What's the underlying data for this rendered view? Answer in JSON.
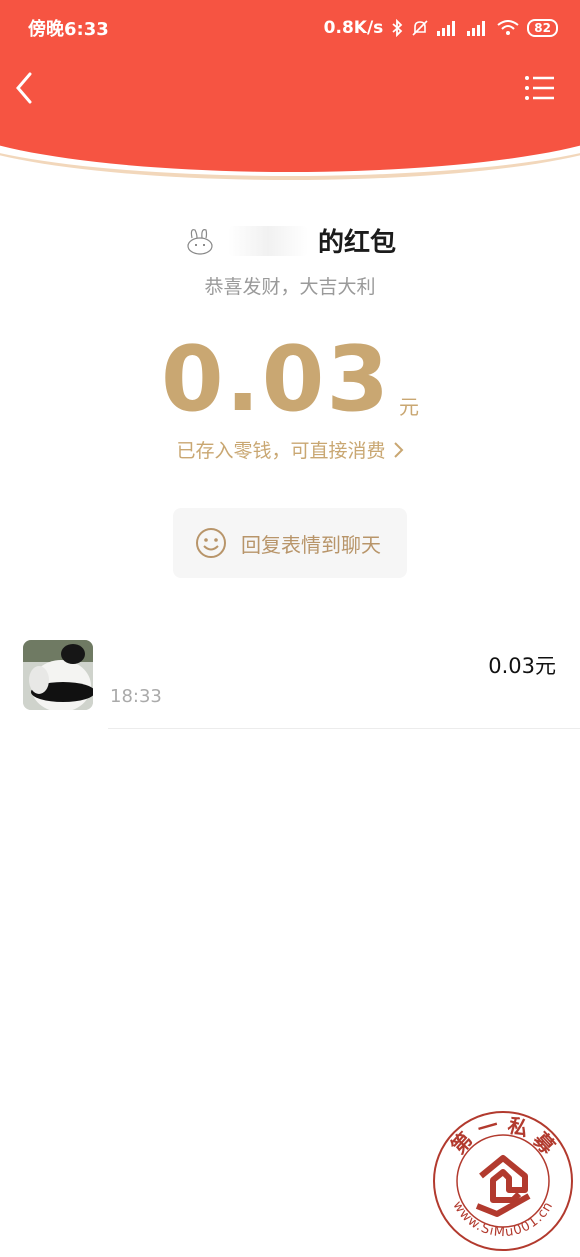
{
  "status_bar": {
    "time": "傍晚6:33",
    "speed": "0.8K/s",
    "battery": "82"
  },
  "nav": {
    "back_icon": "back-chevron-icon",
    "menu_icon": "list-menu-icon"
  },
  "red_packet": {
    "sender_suffix": "的红包",
    "blessing": "恭喜发财，大吉大利",
    "amount": "0.03",
    "unit": "元",
    "stored_text": "已存入零钱，可直接消费"
  },
  "reply_button": {
    "label": "回复表情到聊天",
    "icon": "smiley-icon"
  },
  "records": [
    {
      "time": "18:33",
      "amount": "0.03元"
    }
  ],
  "watermark": {
    "top_text": "第 一 私 募",
    "bottom_text": "www.SiMu001.cn"
  },
  "colors": {
    "header_red": "#f65442",
    "gold": "#c9a772",
    "watermark": "#b23a2e"
  }
}
